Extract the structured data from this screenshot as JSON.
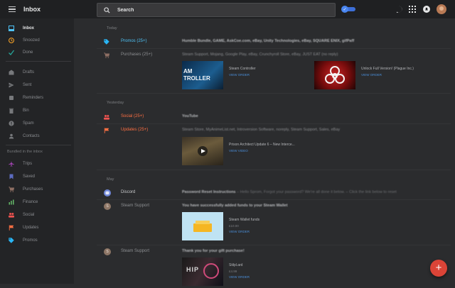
{
  "app": {
    "title": "Inbox"
  },
  "search": {
    "placeholder": "Search"
  },
  "sidebar": {
    "items": [
      {
        "label": "Inbox",
        "icon": "inbox-icon",
        "color": "#4fc3f7"
      },
      {
        "label": "Snoozed",
        "icon": "clock-icon",
        "color": "#ffa726"
      },
      {
        "label": "Done",
        "icon": "check-icon",
        "color": "#26a69a"
      },
      {
        "label": "Drafts",
        "icon": "drafts-icon"
      },
      {
        "label": "Sent",
        "icon": "send-icon"
      },
      {
        "label": "Reminders",
        "icon": "reminder-icon"
      },
      {
        "label": "Bin",
        "icon": "trash-icon"
      },
      {
        "label": "Spam",
        "icon": "spam-icon"
      },
      {
        "label": "Contacts",
        "icon": "contacts-icon"
      }
    ],
    "bundled_heading": "Bundled in the inbox",
    "bundles": [
      {
        "label": "Trips",
        "icon": "plane-icon",
        "color": "#ab47bc"
      },
      {
        "label": "Saved",
        "icon": "bookmark-icon",
        "color": "#5c6bc0"
      },
      {
        "label": "Purchases",
        "icon": "cart-icon",
        "color": "#8d6e63"
      },
      {
        "label": "Finance",
        "icon": "finance-icon",
        "color": "#66bb6a"
      },
      {
        "label": "Social",
        "icon": "people-icon",
        "color": "#ef5350"
      },
      {
        "label": "Updates",
        "icon": "flag-icon",
        "color": "#ff7043"
      },
      {
        "label": "Promos",
        "icon": "tag-icon",
        "color": "#29b6f6"
      }
    ]
  },
  "sections": {
    "today": "Today",
    "yesterday": "Yesterday",
    "may": "May"
  },
  "rows": {
    "promos": {
      "name": "Promos",
      "count": "(25+)",
      "snippet": "Humble Bundle, GAME, AskCoe.com, eBay, Unity Technologies, eBay, SQUARE ENIX, gifPaff"
    },
    "purchases": {
      "name": "Purchases",
      "count": "(25+)",
      "snippet": "Steam Support, Mojang, Google Play, eBay, Crunchyroll Store, eBay, JUST EAT (no reply)"
    },
    "social": {
      "name": "Social",
      "count": "(25+)",
      "snippet": "YouTube"
    },
    "updates": {
      "name": "Updates",
      "count": "(25+)",
      "snippet": "Steam Store, MyAnimeList.net, Introversion Software, noreply, Steam Support, Sales, eBay"
    },
    "discord": {
      "name": "Discord",
      "subject": "Password Reset Instructions",
      "preview": " – Hello Sprom, Forgot your password? We're all done it below. – Click the link below to reset"
    },
    "steam1": {
      "name": "Steam Support",
      "subject": "You have successfully added funds to your Steam Wallet"
    },
    "steam2": {
      "name": "Steam Support",
      "subject": "Thank you for your gift purchase!"
    }
  },
  "cards": [
    {
      "title": "Steam Controller",
      "sub": "",
      "link": "VIEW ORDER",
      "art": "AM\nTROLLER"
    },
    {
      "title": "Unlock Full Version! (Plague Inc.)",
      "sub": "",
      "link": "VIEW ORDER"
    },
    {
      "title": "Prison Architect Update 6 – New Interce...",
      "sub": "",
      "link": "VIEW VIDEO"
    },
    {
      "title": "Steam Wallet funds",
      "sub": "£10.00",
      "link": "VIEW ORDER"
    },
    {
      "title": "Stilpl.ard",
      "sub": "£4.99",
      "link": "VIEW ORDER"
    }
  ],
  "fab": {
    "label": "+"
  }
}
